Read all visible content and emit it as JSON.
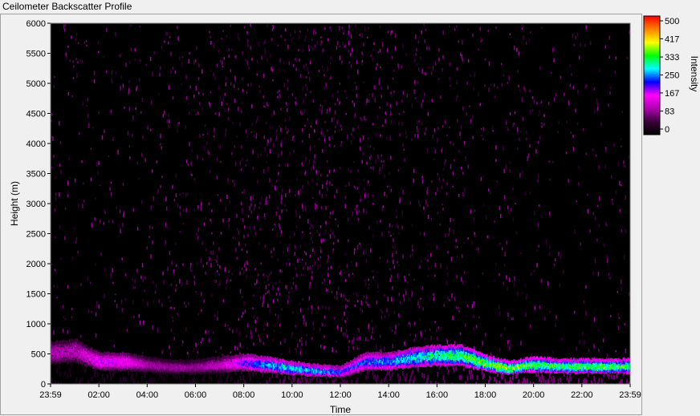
{
  "window": {
    "title": "Ceilometer Backscatter Profile"
  },
  "colors": {
    "plot_background": "#000000",
    "colormap": [
      "#000000",
      "#3a003a",
      "#b000b0",
      "#ff00ff",
      "#0000ff",
      "#00ffff",
      "#00ff00",
      "#ffff00",
      "#ff8000",
      "#ff0000"
    ]
  },
  "chart_data": {
    "type": "heatmap",
    "title": "",
    "xlabel": "Time",
    "ylabel": "Height (m)",
    "colorbar_label": "Intensity",
    "x_tick_labels": [
      "23:59",
      "02:00",
      "04:00",
      "06:00",
      "08:00",
      "10:00",
      "12:00",
      "14:00",
      "16:00",
      "18:00",
      "20:00",
      "22:00",
      "23:59"
    ],
    "y_tick_labels": [
      "0",
      "500",
      "1000",
      "1500",
      "2000",
      "2500",
      "3000",
      "3500",
      "4000",
      "4500",
      "5000",
      "5500",
      "6000"
    ],
    "y_ticks": [
      0,
      500,
      1000,
      1500,
      2000,
      2500,
      3000,
      3500,
      4000,
      4500,
      5000,
      5500,
      6000
    ],
    "x_ticks_hours": [
      0,
      2,
      4,
      6,
      8,
      10,
      12,
      14,
      16,
      18,
      20,
      22,
      24
    ],
    "xlim_hours": [
      0,
      24
    ],
    "ylim": [
      0,
      6000
    ],
    "colorbar_ticks": [
      0,
      83,
      167,
      250,
      333,
      417,
      500
    ],
    "colorbar_tick_labels": [
      "0",
      "83",
      "167",
      "250",
      "333",
      "417",
      "500"
    ],
    "colorbar_range": [
      0,
      500
    ],
    "grid": false,
    "boundary_layer": {
      "description_hours": [
        0,
        1,
        2,
        3,
        4,
        5,
        6,
        7,
        8,
        9,
        10,
        11,
        12,
        13,
        14,
        15,
        16,
        17,
        18,
        19,
        20,
        21,
        22,
        23,
        24
      ],
      "top_height_m": [
        700,
        750,
        520,
        520,
        450,
        400,
        400,
        450,
        500,
        450,
        380,
        330,
        300,
        520,
        520,
        600,
        650,
        650,
        480,
        380,
        460,
        420,
        420,
        420,
        420
      ],
      "peak_intensity": [
        120,
        120,
        170,
        170,
        110,
        100,
        100,
        130,
        200,
        260,
        280,
        260,
        220,
        230,
        250,
        280,
        300,
        320,
        350,
        360,
        330,
        320,
        330,
        330,
        330
      ]
    },
    "noise_region": {
      "max_intensity": 110,
      "height_range": [
        1000,
        6000
      ]
    }
  }
}
